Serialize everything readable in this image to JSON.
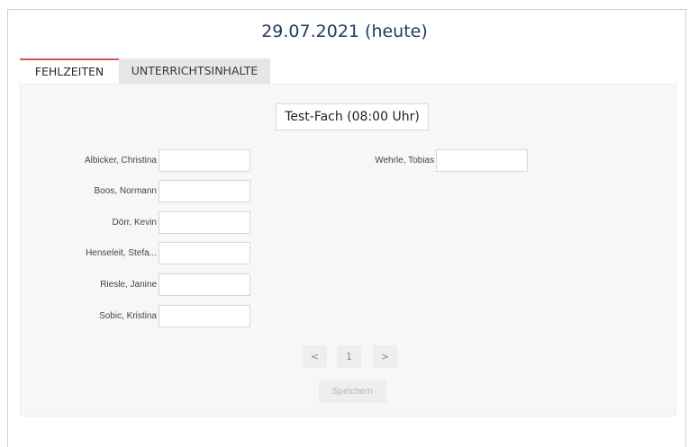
{
  "header": {
    "date_title": "29.07.2021 (heute)"
  },
  "tabs": [
    {
      "label": "FEHLZEITEN",
      "active": true
    },
    {
      "label": "UNTERRICHTSINHALTE",
      "active": false
    }
  ],
  "subject": {
    "label": "Test-Fach (08:00 Uhr)"
  },
  "students_left": [
    {
      "name": "Albicker, Christina",
      "value": ""
    },
    {
      "name": "Boos, Normann",
      "value": ""
    },
    {
      "name": "Dörr, Kevin",
      "value": ""
    },
    {
      "name": "Henseleit, Stefa...",
      "value": ""
    },
    {
      "name": "Riesle, Janine",
      "value": ""
    },
    {
      "name": "Sobic, Kristina",
      "value": ""
    }
  ],
  "students_right": [
    {
      "name": "Wehrle, Tobias",
      "value": ""
    }
  ],
  "pagination": {
    "prev": "<",
    "page": "1",
    "next": ">"
  },
  "actions": {
    "save_label": "Speichern"
  },
  "colors": {
    "accent_tab": "#d9534f",
    "title": "#1f3a5f"
  }
}
